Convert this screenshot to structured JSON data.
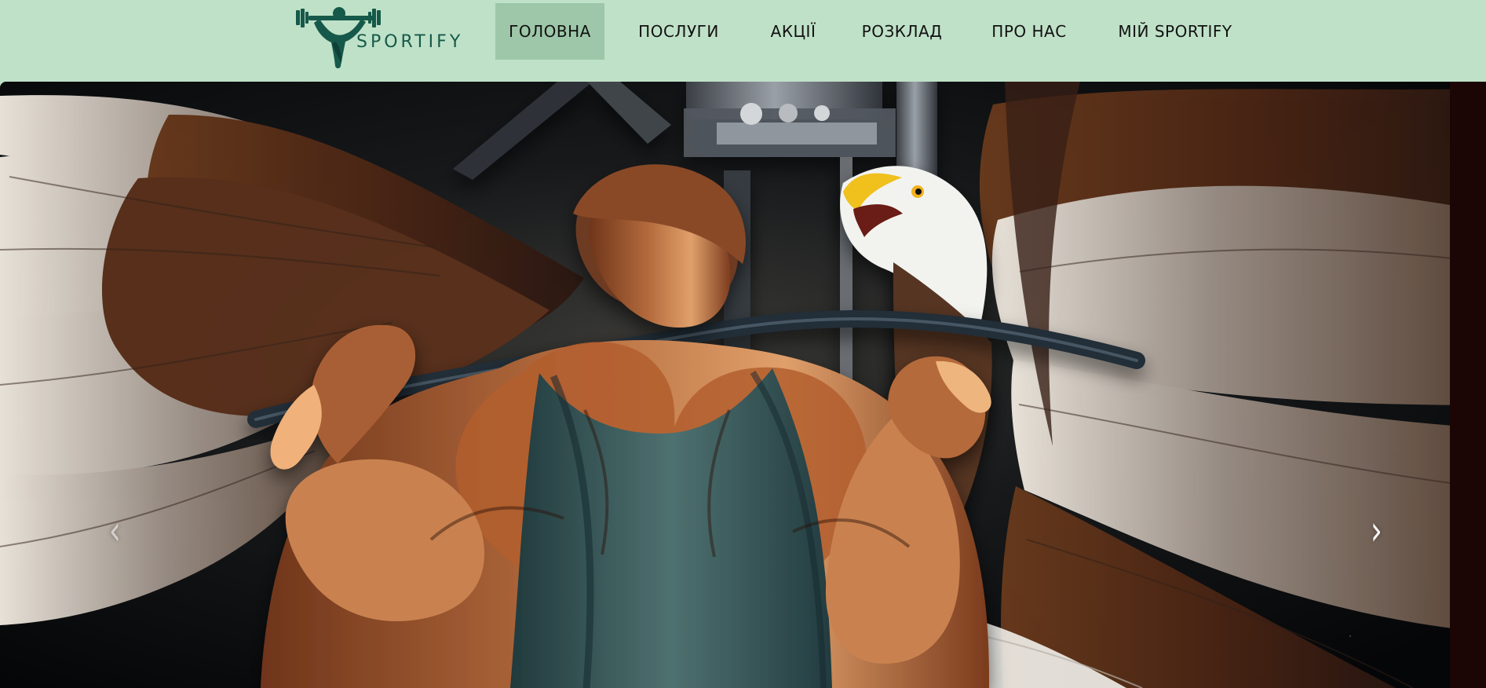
{
  "brand": {
    "name": "SPORTIFY",
    "logo_icon": "weightlifter-icon",
    "logo_color": "#16594a"
  },
  "nav": {
    "items": [
      {
        "label": "ГОЛОВНА",
        "active": true
      },
      {
        "label": "ПОСЛУГИ",
        "active": false
      },
      {
        "label": "АКЦІЇ",
        "active": false
      },
      {
        "label": "РОЗКЛАД",
        "active": false
      },
      {
        "label": "ПРО НАС",
        "active": false
      },
      {
        "label": "МІЙ SPORTIFY",
        "active": false
      }
    ],
    "background_color": "#bfe1c8",
    "active_color": "#9dc7a8"
  },
  "hero": {
    "image": "athlete-with-eagle-wings-illustration",
    "previous_icon": "chevron-left-icon",
    "next_icon": "chevron-right-icon"
  }
}
